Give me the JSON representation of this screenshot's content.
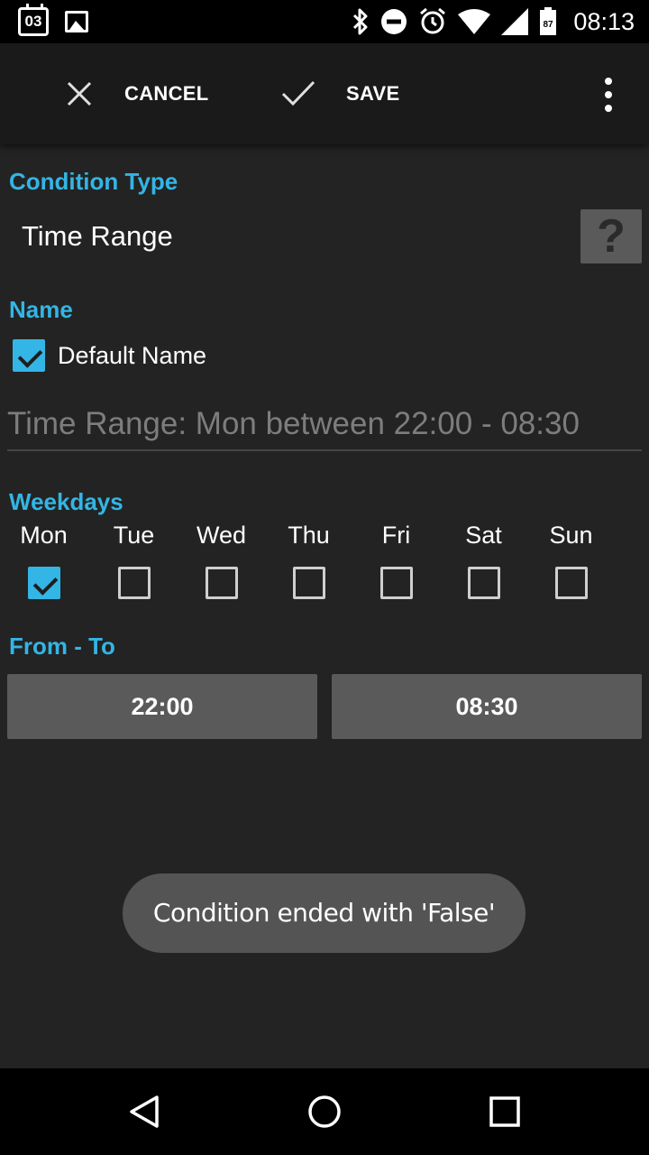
{
  "status_bar": {
    "calendar_date": "03",
    "battery_level": "87",
    "time": "08:13",
    "icons": [
      "calendar-icon",
      "image-icon",
      "bluetooth-icon",
      "do-not-disturb-icon",
      "alarm-icon",
      "wifi-icon",
      "signal-icon",
      "battery-icon"
    ]
  },
  "action_bar": {
    "cancel_label": "CANCEL",
    "save_label": "SAVE"
  },
  "condition_type": {
    "label": "Condition Type",
    "value": "Time Range",
    "help_label": "?"
  },
  "name": {
    "label": "Name",
    "default_name_label": "Default Name",
    "default_name_checked": true,
    "field_value": "Time Range: Mon between 22:00 - 08:30"
  },
  "weekdays": {
    "label": "Weekdays",
    "days": [
      {
        "label": "Mon",
        "checked": true
      },
      {
        "label": "Tue",
        "checked": false
      },
      {
        "label": "Wed",
        "checked": false
      },
      {
        "label": "Thu",
        "checked": false
      },
      {
        "label": "Fri",
        "checked": false
      },
      {
        "label": "Sat",
        "checked": false
      },
      {
        "label": "Sun",
        "checked": false
      }
    ]
  },
  "from_to": {
    "label": "From - To",
    "from": "22:00",
    "to": "08:30"
  },
  "toast": {
    "message": "Condition ended with 'False'"
  },
  "colors": {
    "accent": "#33b5e5",
    "background": "#232323",
    "button": "#5a5a5a"
  }
}
